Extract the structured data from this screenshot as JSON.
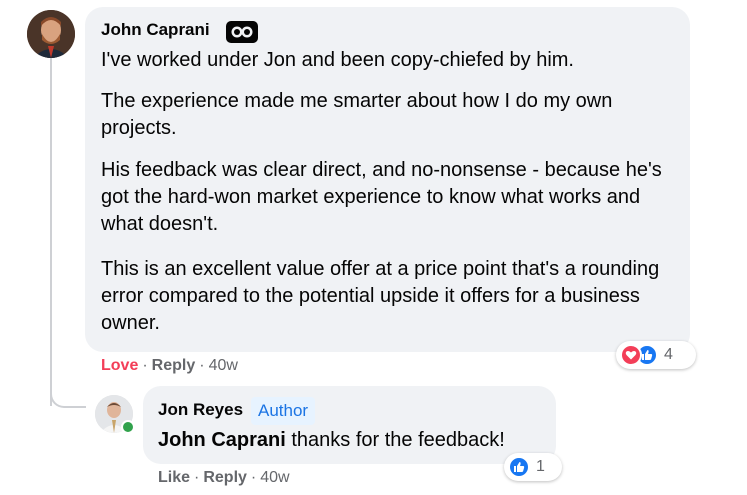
{
  "comment": {
    "author": "John Caprani",
    "badge_icon": "top-fan-badge-icon",
    "paragraphs": [
      "I've worked under Jon and been copy-chiefed by him.",
      "The experience made me smarter about how I do my own projects.",
      "His feedback was clear direct, and no-nonsense - because he's got the hard-won market experience to know what works and what doesn't.",
      "This is an excellent value offer at a price point that's a rounding error compared to the potential upside it offers for a business owner."
    ],
    "actions": {
      "love": "Love",
      "reply": "Reply",
      "time": "40w"
    },
    "reactions": {
      "icons": [
        "love-reaction-icon",
        "like-reaction-icon"
      ],
      "count": "4"
    }
  },
  "reply": {
    "author": "Jon Reyes",
    "author_badge": "Author",
    "mention": "John Caprani",
    "text": " thanks for the feedback!",
    "actions": {
      "like": "Like",
      "reply": "Reply",
      "time": "40w"
    },
    "reactions": {
      "icons": [
        "like-reaction-icon"
      ],
      "count": "1"
    }
  },
  "colors": {
    "bubble": "#f0f2f5",
    "love": "#f33e58",
    "like": "#1877f2",
    "author_badge_bg": "#e7f3ff",
    "author_badge_text": "#1b74e4",
    "online": "#31a24c"
  }
}
